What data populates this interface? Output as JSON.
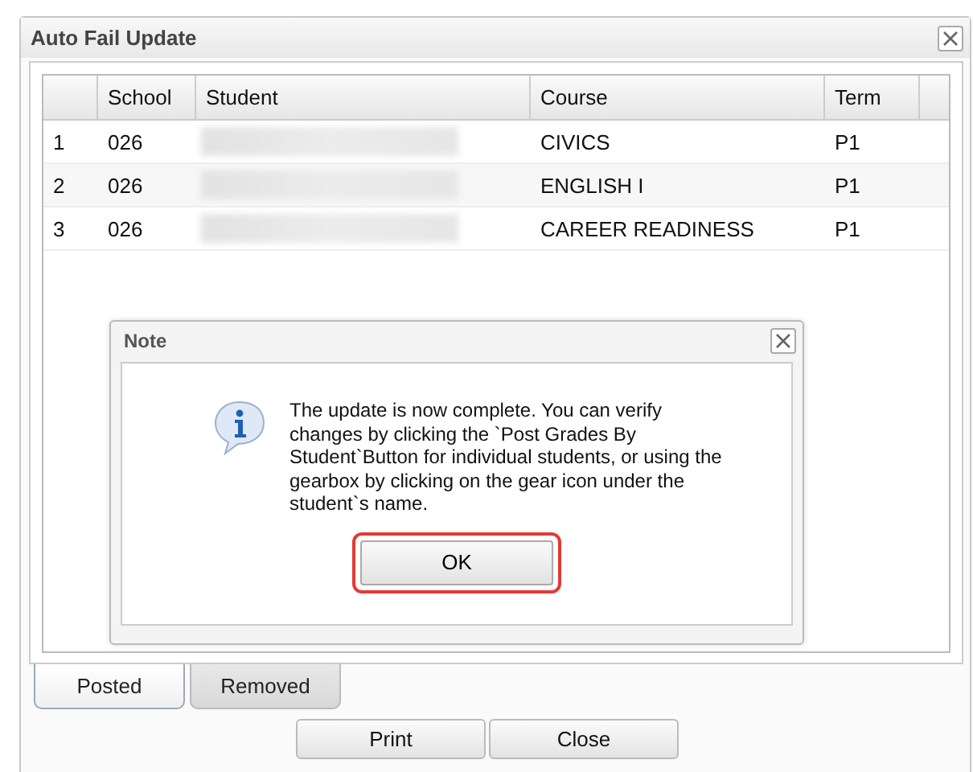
{
  "window": {
    "title": "Auto Fail Update"
  },
  "table": {
    "columns": [
      "School",
      "Student",
      "Course",
      "Term"
    ],
    "rows": [
      {
        "number": "1",
        "school": "026",
        "course": "CIVICS",
        "term": "P1"
      },
      {
        "number": "2",
        "school": "026",
        "course": "ENGLISH I",
        "term": "P1"
      },
      {
        "number": "3",
        "school": "026",
        "course": "CAREER READINESS",
        "term": "P1"
      }
    ]
  },
  "dialog": {
    "title": "Note",
    "message": "The update is now complete. You can verify changes by clicking the `Post Grades By Student`Button for individual students, or using the gearbox by clicking on the gear icon under the student`s name.",
    "button": "OK"
  },
  "tabs": [
    {
      "label": "Posted",
      "selected": true
    },
    {
      "label": "Removed",
      "selected": false
    }
  ],
  "buttons": [
    "Print",
    "Close"
  ]
}
